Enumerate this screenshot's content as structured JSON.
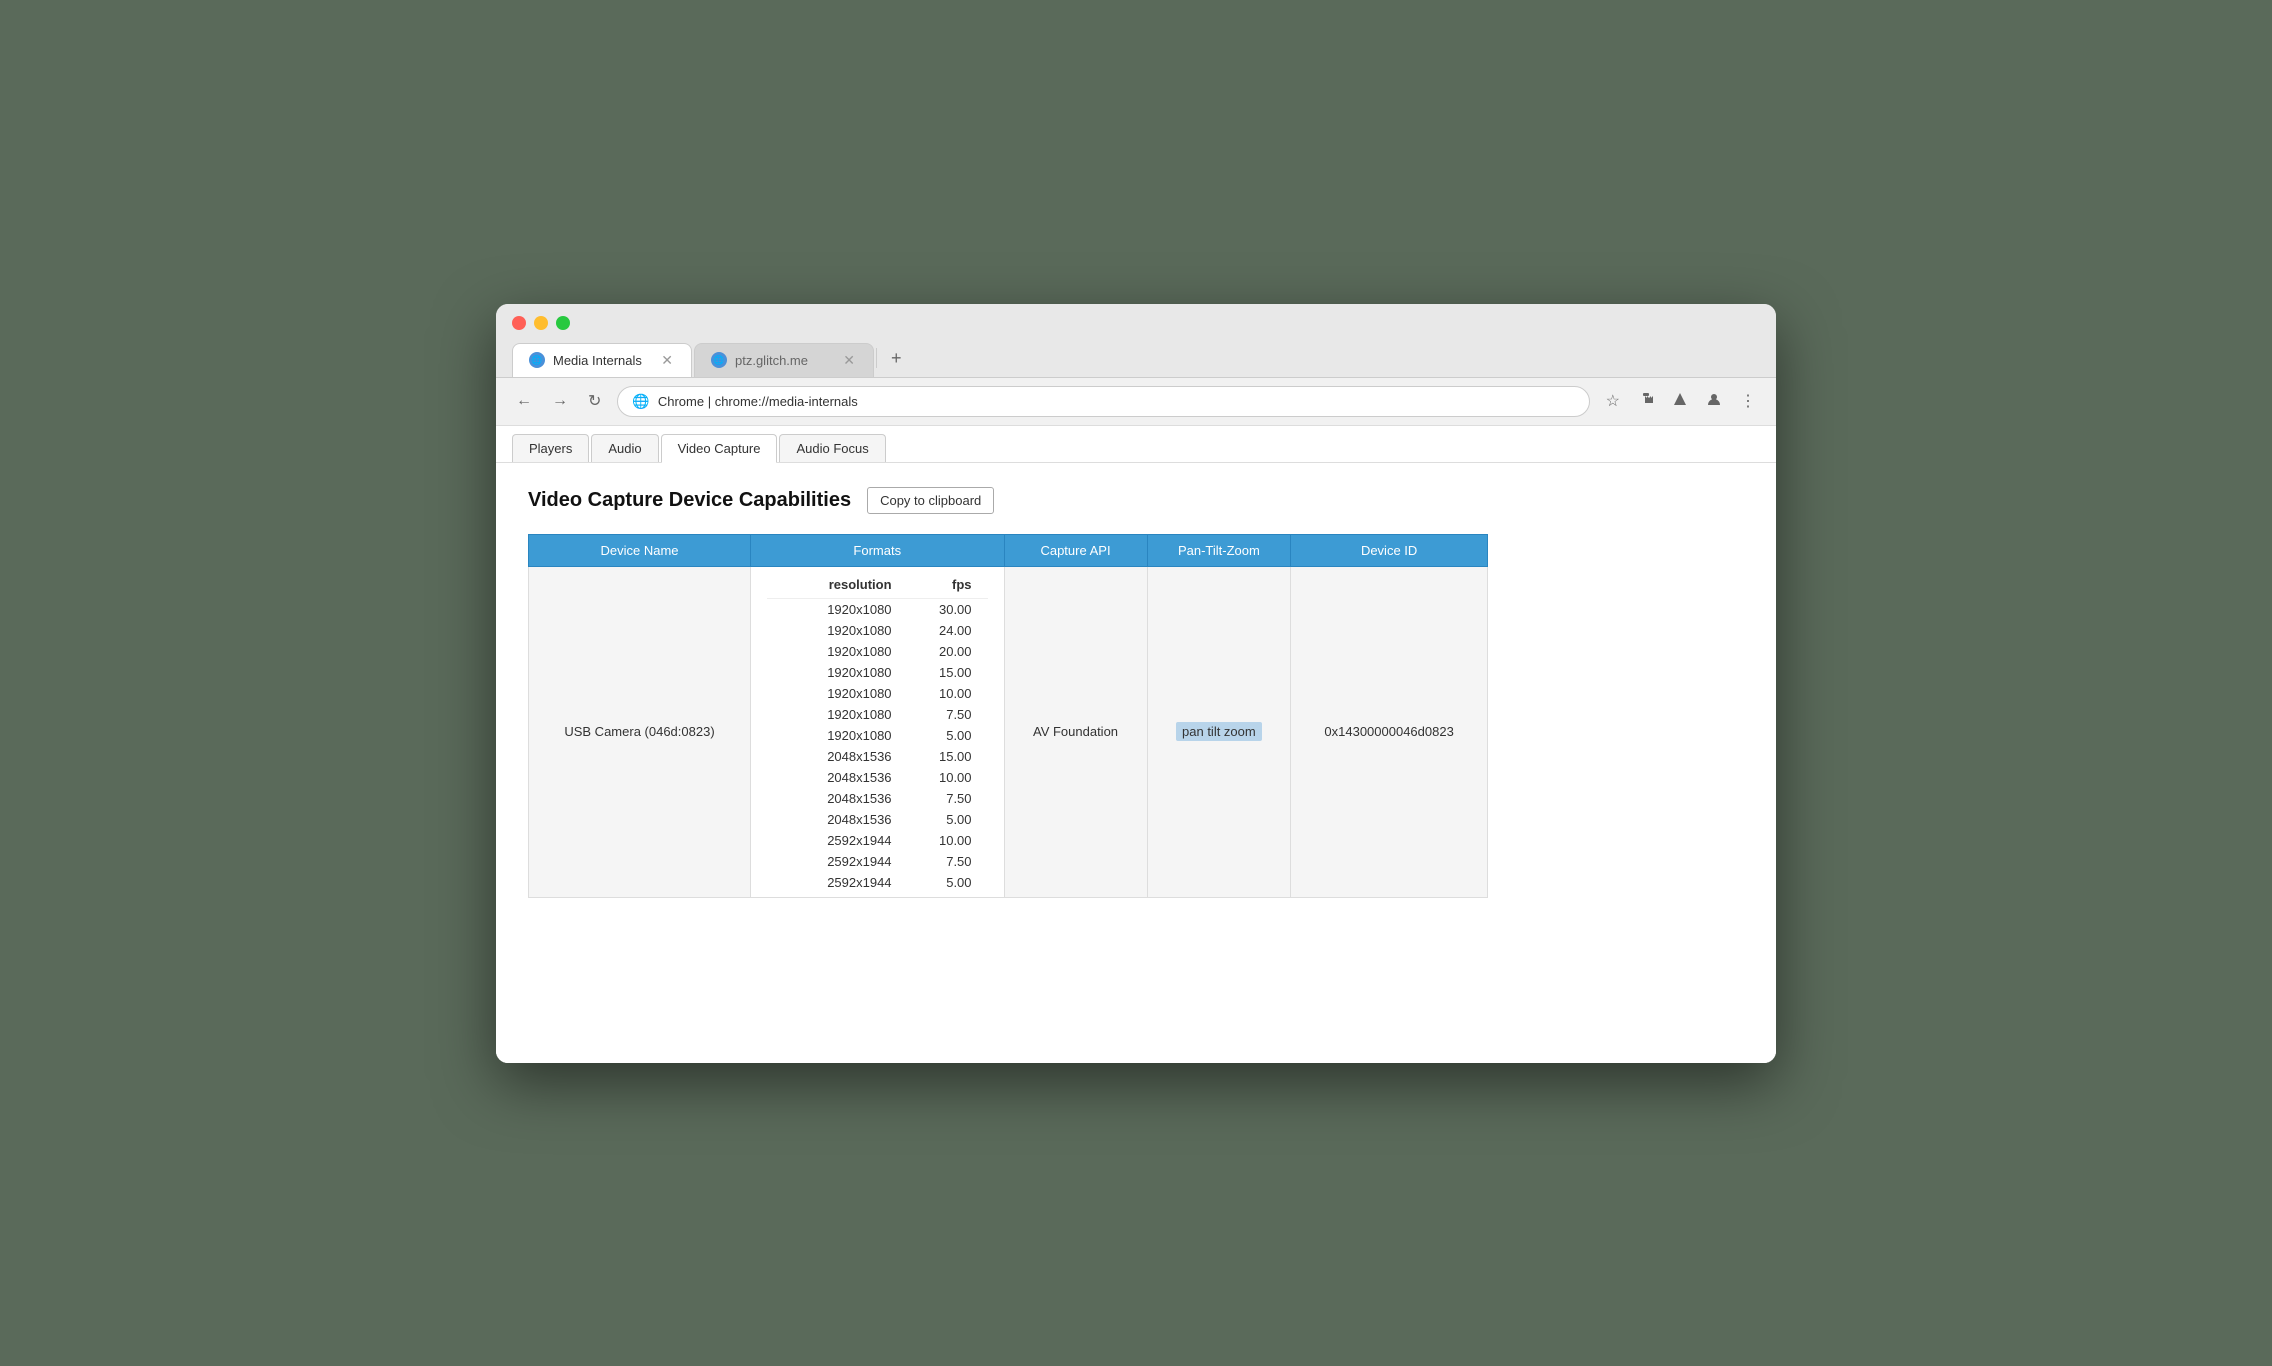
{
  "browser": {
    "tabs": [
      {
        "id": "media-internals",
        "icon_label": "●",
        "label": "Media Internals",
        "url": "chrome://media-internals",
        "active": true
      },
      {
        "id": "ptz-glitch",
        "icon_label": "●",
        "label": "ptz.glitch.me",
        "url": "https://ptz.glitch.me",
        "active": false
      }
    ],
    "address_bar": {
      "icon": "🌐",
      "prefix": "Chrome | ",
      "url": "chrome://media-internals"
    }
  },
  "internal_tabs": [
    {
      "id": "players",
      "label": "Players",
      "active": false
    },
    {
      "id": "audio",
      "label": "Audio",
      "active": false
    },
    {
      "id": "video-capture",
      "label": "Video Capture",
      "active": true
    },
    {
      "id": "audio-focus",
      "label": "Audio Focus",
      "active": false
    }
  ],
  "page": {
    "title": "Video Capture Device Capabilities",
    "copy_button_label": "Copy to clipboard",
    "table": {
      "headers": [
        "Device Name",
        "Formats",
        "Capture API",
        "Pan-Tilt-Zoom",
        "Device ID"
      ],
      "formats_sub_headers": [
        "resolution",
        "fps"
      ],
      "rows": [
        {
          "device_name": "USB Camera (046d:0823)",
          "formats": [
            {
              "resolution": "1920x1080",
              "fps": "30.00"
            },
            {
              "resolution": "1920x1080",
              "fps": "24.00"
            },
            {
              "resolution": "1920x1080",
              "fps": "20.00"
            },
            {
              "resolution": "1920x1080",
              "fps": "15.00"
            },
            {
              "resolution": "1920x1080",
              "fps": "10.00"
            },
            {
              "resolution": "1920x1080",
              "fps": "7.50"
            },
            {
              "resolution": "1920x1080",
              "fps": "5.00"
            },
            {
              "resolution": "2048x1536",
              "fps": "15.00"
            },
            {
              "resolution": "2048x1536",
              "fps": "10.00"
            },
            {
              "resolution": "2048x1536",
              "fps": "7.50"
            },
            {
              "resolution": "2048x1536",
              "fps": "5.00"
            },
            {
              "resolution": "2592x1944",
              "fps": "10.00"
            },
            {
              "resolution": "2592x1944",
              "fps": "7.50"
            },
            {
              "resolution": "2592x1944",
              "fps": "5.00"
            }
          ],
          "capture_api": "AV Foundation",
          "ptz": "pan tilt zoom",
          "device_id": "0x14300000046d0823"
        }
      ]
    }
  },
  "icons": {
    "back": "←",
    "forward": "→",
    "refresh": "↻",
    "star": "☆",
    "extensions": "⚡",
    "screenshare": "▲",
    "profile": "●",
    "menu": "⋮",
    "close": "✕",
    "new_tab": "+"
  },
  "colors": {
    "table_header_bg": "#3d9bd4",
    "ptz_highlight_bg": "#b8d4ea"
  }
}
